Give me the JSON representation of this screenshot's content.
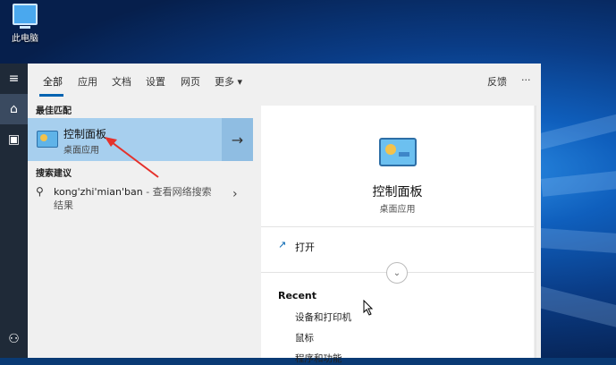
{
  "desktop": {
    "this_pc_label": "此电脑"
  },
  "tabs": {
    "items": [
      "全部",
      "应用",
      "文档",
      "设置",
      "网页",
      "更多 ▾"
    ],
    "feedback": "反馈",
    "more_dots": "···"
  },
  "left": {
    "best_match_heading": "最佳匹配",
    "best_match": {
      "title": "控制面板",
      "subtitle": "桌面应用",
      "arrow": "→"
    },
    "suggest_heading": "搜索建议",
    "suggestion": {
      "query": "kong'zhi'mian'ban",
      "hint": " - 查看网络搜索结果",
      "chevron": "›"
    }
  },
  "right": {
    "title": "控制面板",
    "subtitle": "桌面应用",
    "open_label": "打开",
    "recent_heading": "Recent",
    "recent_items": [
      "设备和打印机",
      "鼠标",
      "程序和功能"
    ]
  },
  "icons": {
    "hamburger": "≡",
    "home": "⌂",
    "tablet": "▣",
    "person": "⚇",
    "search": "⚲",
    "open": "↗",
    "expand": "⌄"
  },
  "colors": {
    "accent": "#0063b1",
    "selection": "#a7cfee",
    "rail": "#1f2a38",
    "annotation_arrow": "#e5312b"
  }
}
